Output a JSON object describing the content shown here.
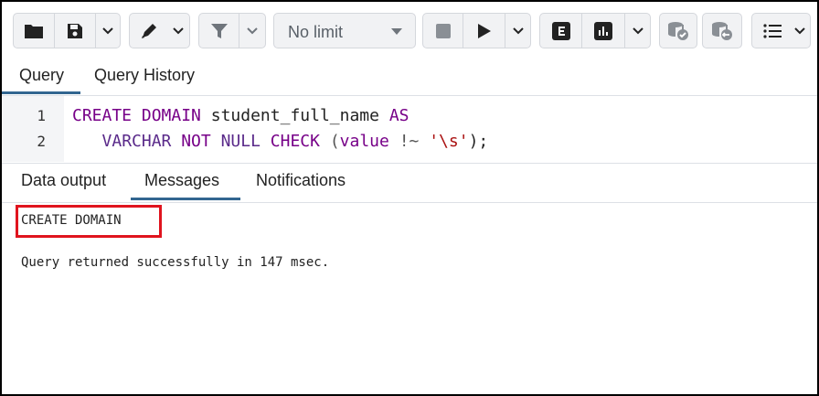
{
  "toolbar": {
    "limit_value": "No limit",
    "icons": [
      "folder-icon",
      "save-icon",
      "chevron-down-icon",
      "edit-pen-icon",
      "filter-icon",
      "stop-icon",
      "play-icon",
      "explain-icon",
      "explain-analyze-icon",
      "commit-icon",
      "rollback-icon",
      "macros-icon"
    ]
  },
  "query_tabs": [
    {
      "label": "Query",
      "active": true
    },
    {
      "label": "Query History",
      "active": false
    }
  ],
  "editor": {
    "lines": [
      {
        "num": "1"
      },
      {
        "num": "2"
      }
    ],
    "line1": {
      "kw1": "CREATE",
      "kw2": "DOMAIN",
      "ident": "student_full_name",
      "kw3": "AS"
    },
    "line2": {
      "type": "VARCHAR",
      "not": "NOT",
      "null": "NULL",
      "check": "CHECK",
      "open": "(",
      "value": "value",
      "op": "!~",
      "str": "'\\s'",
      "close": ");"
    }
  },
  "result_tabs": [
    {
      "label": "Data output",
      "active": false
    },
    {
      "label": "Messages",
      "active": true
    },
    {
      "label": "Notifications",
      "active": false
    }
  ],
  "messages": {
    "result": "CREATE DOMAIN",
    "status": "Query returned successfully in 147 msec."
  },
  "colors": {
    "accent": "#326690",
    "highlight": "#e0141e",
    "keyword": "#770088",
    "string": "#aa1111"
  }
}
